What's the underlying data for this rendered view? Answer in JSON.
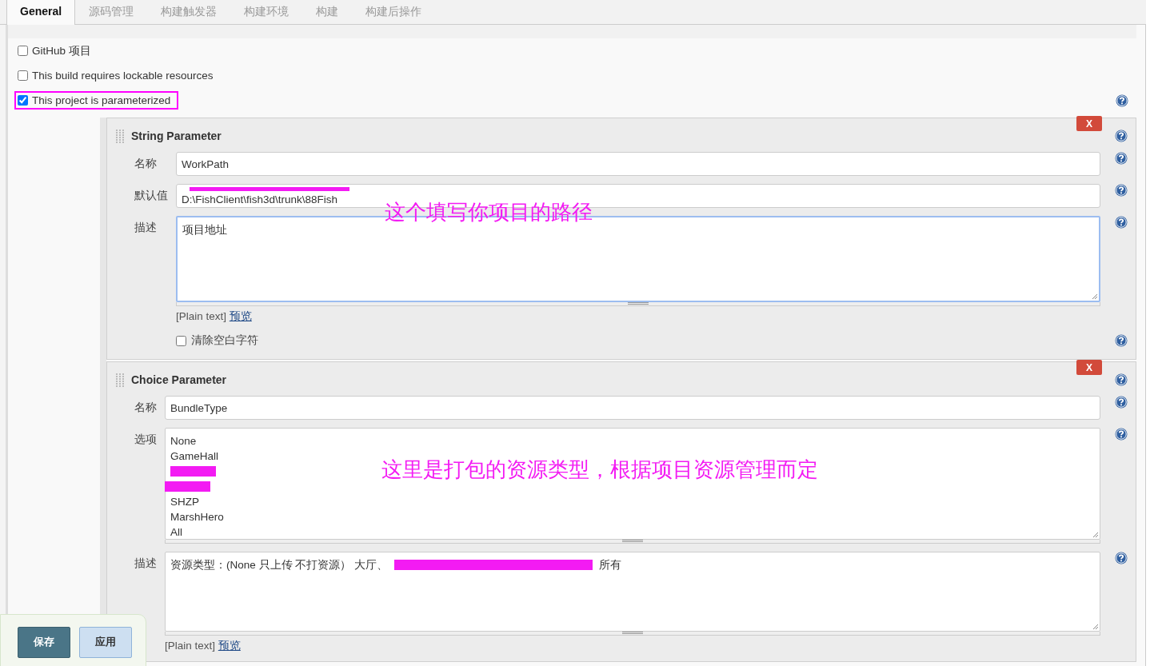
{
  "tabs": [
    {
      "label": "General",
      "selected": true
    },
    {
      "label": "源码管理",
      "selected": false
    },
    {
      "label": "构建触发器",
      "selected": false
    },
    {
      "label": "构建环境",
      "selected": false
    },
    {
      "label": "构建",
      "selected": false
    },
    {
      "label": "构建后操作",
      "selected": false
    }
  ],
  "options": [
    {
      "label": "GitHub 项目",
      "checked": false,
      "highlighted": false
    },
    {
      "label": "This build requires lockable resources",
      "checked": false,
      "highlighted": false
    },
    {
      "label": "This project is parameterized",
      "checked": true,
      "highlighted": true
    }
  ],
  "parameters": [
    {
      "title": "String Parameter",
      "delete_label": "X",
      "annotation": "这个填写你项目的路径",
      "fields": [
        {
          "kind": "input",
          "label": "名称",
          "value": "WorkPath"
        },
        {
          "kind": "input",
          "label": "默认值",
          "value": "D:\\FishClient\\fish3d\\trunk\\88Fish",
          "redacted": true
        },
        {
          "kind": "textarea",
          "label": "描述",
          "focused": true,
          "lines": [
            [
              {
                "kind": "text",
                "text": "项目地址"
              }
            ]
          ],
          "preview": {
            "format": "[Plain text]",
            "link": "预览"
          }
        }
      ],
      "trim": {
        "label": "清除空白字符",
        "checked": false
      }
    },
    {
      "title": "Choice Parameter",
      "delete_label": "X",
      "annotation": "这里是打包的资源类型，根据项目资源管理而定",
      "fields": [
        {
          "kind": "input",
          "label": "名称",
          "value": "BundleType"
        },
        {
          "kind": "textarea",
          "label": "选项",
          "focused": false,
          "lines": [
            [
              {
                "kind": "text",
                "text": "None"
              }
            ],
            [
              {
                "kind": "text",
                "text": "GameHall"
              }
            ],
            [
              {
                "kind": "redacted"
              }
            ],
            [
              {
                "kind": "redacted"
              }
            ],
            [
              {
                "kind": "text",
                "text": "SHZP"
              }
            ],
            [
              {
                "kind": "text",
                "text": "MarshHero"
              }
            ],
            [
              {
                "kind": "text",
                "text": "All"
              }
            ]
          ]
        },
        {
          "kind": "textarea",
          "label": "描述",
          "focused": false,
          "lines": [
            [
              {
                "kind": "text",
                "text": "资源类型：(None 只上传 不打资源） 大厅、"
              },
              {
                "kind": "redacted"
              },
              {
                "kind": "text",
                "text": "所有"
              }
            ]
          ],
          "preview": {
            "format": "[Plain text]",
            "link": "预览"
          }
        }
      ]
    }
  ],
  "buttons": [
    {
      "label": "保存",
      "kind": "primary"
    },
    {
      "label": "应用",
      "kind": "secondary"
    }
  ]
}
